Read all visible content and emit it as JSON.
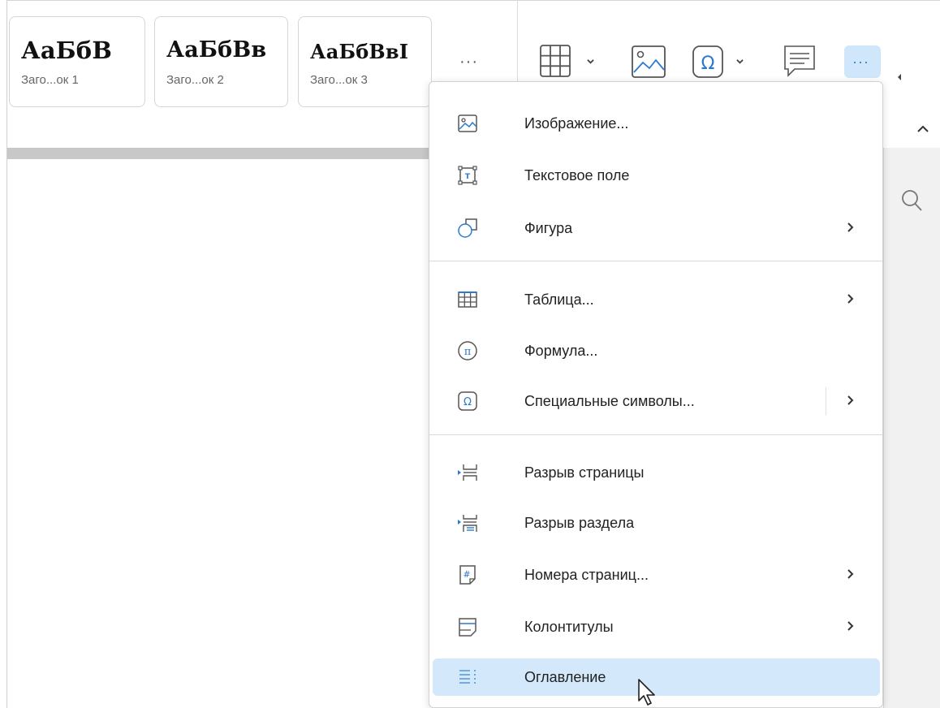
{
  "styles": [
    {
      "sample": "АаБбВ",
      "caption": "Заго...ок 1"
    },
    {
      "sample": "АаБбВв",
      "caption": "Заго...ок 2"
    },
    {
      "sample": "АаБбВвI",
      "caption": "Заго...ок 3"
    }
  ],
  "styles_more": "···",
  "toolbar": {
    "more_label": "···",
    "icons": [
      "table-icon",
      "image-icon",
      "special-symbol-icon",
      "comment-icon",
      "more-icon"
    ]
  },
  "menu": {
    "items": [
      {
        "label": "Изображение...",
        "icon": "image-icon",
        "submenu": false
      },
      {
        "label": "Текстовое поле",
        "icon": "text-box-icon",
        "submenu": false
      },
      {
        "label": "Фигура",
        "icon": "shape-icon",
        "submenu": true
      },
      {
        "label": "Таблица...",
        "icon": "table-icon",
        "submenu": true
      },
      {
        "label": "Формула...",
        "icon": "formula-icon",
        "submenu": false
      },
      {
        "label": "Специальные символы...",
        "icon": "special-symbol-icon",
        "submenu": true
      },
      {
        "label": "Разрыв страницы",
        "icon": "page-break-icon",
        "submenu": false
      },
      {
        "label": "Разрыв раздела",
        "icon": "section-break-icon",
        "submenu": false
      },
      {
        "label": "Номера страниц...",
        "icon": "page-numbers-icon",
        "submenu": true
      },
      {
        "label": "Колонтитулы",
        "icon": "header-footer-icon",
        "submenu": true
      },
      {
        "label": "Оглавление",
        "icon": "toc-icon",
        "submenu": false,
        "highlighted": true
      }
    ]
  },
  "colors": {
    "accent": "#2a7ad2",
    "highlight": "#d4e8fb",
    "icon_gray": "#666666"
  }
}
